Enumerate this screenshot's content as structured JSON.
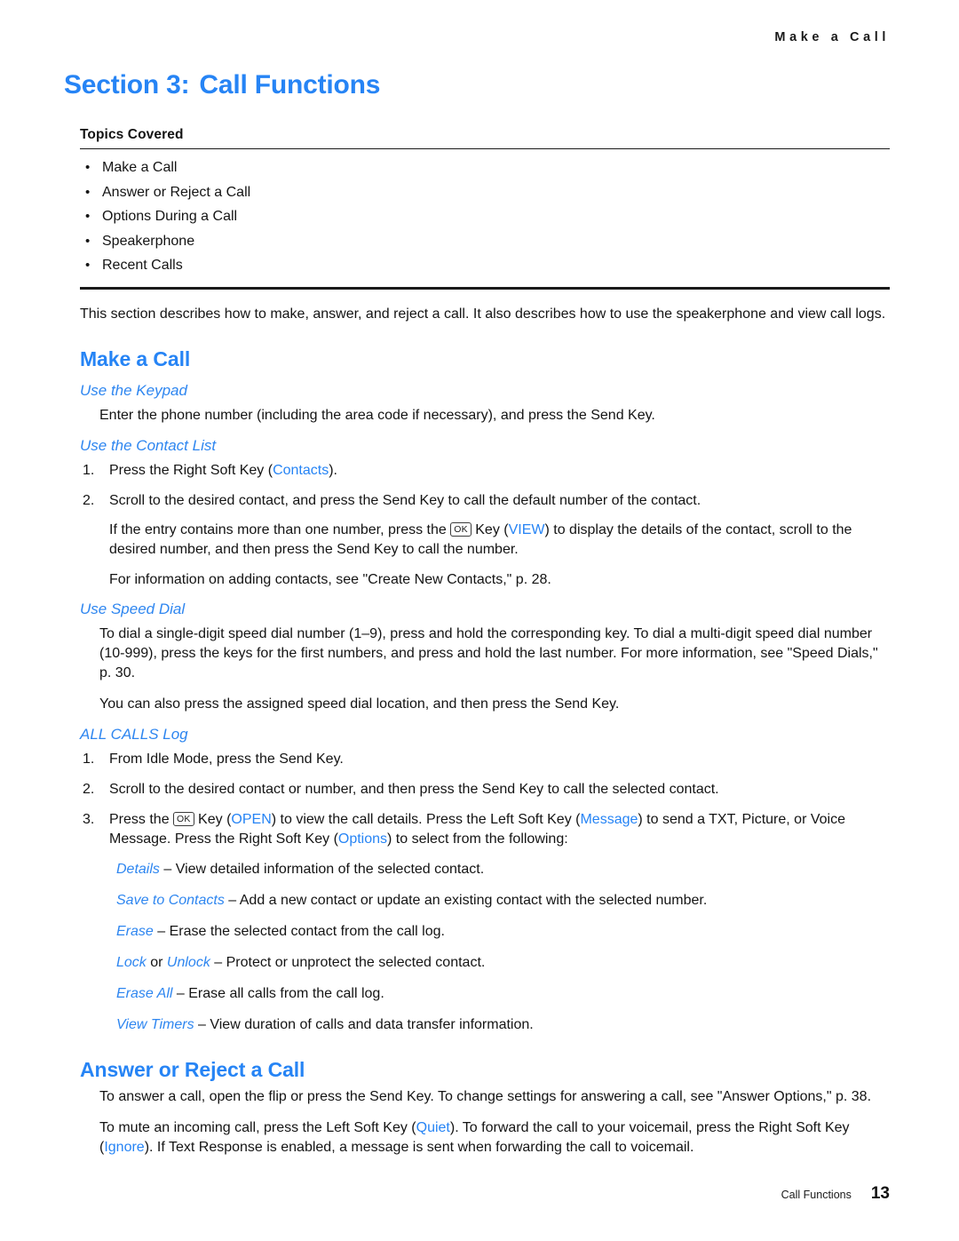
{
  "running_header": "Make a Call",
  "section": {
    "label": "Section 3:",
    "title": "Call Functions"
  },
  "topics": {
    "label": "Topics Covered",
    "bullet_glyph": "•",
    "items": [
      "Make a Call",
      "Answer or Reject a Call",
      "Options During a Call",
      "Speakerphone",
      "Recent Calls"
    ]
  },
  "intro": "This section describes how to make, answer, and reject a call. It also describes how to use the speakerphone and view call logs.",
  "make_a_call": {
    "heading": "Make a Call",
    "keypad": {
      "heading": "Use the Keypad",
      "text": "Enter the phone number (including the area code if necessary), and press the Send Key."
    },
    "contact_list": {
      "heading": "Use the Contact List",
      "step1": {
        "num": "1.",
        "pre": "Press the Right Soft Key (",
        "link": "Contacts",
        "post": ")."
      },
      "step2": {
        "num": "2.",
        "text": "Scroll to the desired contact, and press the Send Key to call the default number of the contact.",
        "note_pre": "If the entry contains more than one number, press the ",
        "okkey": "OK",
        "note_mid": " Key (",
        "note_link": "VIEW",
        "note_post": ") to display the details of the contact, scroll to the desired number, and then press the Send Key to call the number."
      },
      "footnote": "For information on adding contacts, see \"Create New Contacts,\" p. 28."
    },
    "speed_dial": {
      "heading": "Use Speed Dial",
      "para1": "To dial a single-digit speed dial number (1–9), press and hold the corresponding key. To dial a multi-digit speed dial number (10-999), press the keys for the first numbers, and press and hold the last number. For more information, see \"Speed Dials,\" p. 30.",
      "para2": "You can also press the assigned speed dial location, and then press the Send Key."
    },
    "all_calls": {
      "heading": "ALL CALLS Log",
      "step1": {
        "num": "1.",
        "text": "From Idle Mode, press the Send Key."
      },
      "step2": {
        "num": "2.",
        "text": "Scroll to the desired contact or number, and then press the Send Key to call the selected contact."
      },
      "step3": {
        "num": "3.",
        "p1": "Press the ",
        "okkey": "OK",
        "p2": " Key (",
        "link_open": "OPEN",
        "p3": ") to view the call details. Press the Left Soft Key (",
        "link_message": "Message",
        "p4": ") to send a TXT, Picture, or Voice Message. Press the Right Soft Key (",
        "link_options": "Options",
        "p5": ") to select from the following:"
      },
      "options": [
        {
          "term": "Details",
          "desc": " – View detailed information of the selected contact."
        },
        {
          "term": "Save to Contacts",
          "desc": " – Add a new contact or update an existing contact with the selected number."
        },
        {
          "term": "Erase",
          "desc": " – Erase the selected contact from the call log."
        },
        {
          "term": "Lock",
          "conj": " or ",
          "term2": "Unlock",
          "desc": " – Protect or unprotect the selected contact."
        },
        {
          "term": "Erase All",
          "desc": " – Erase all calls from the call log."
        },
        {
          "term": "View Timers",
          "desc": " – View duration of calls and data transfer information."
        }
      ]
    }
  },
  "answer_reject": {
    "heading": "Answer or Reject a Call",
    "para1": "To answer a call, open the flip or press the Send Key. To change settings for answering a call, see \"Answer Options,\" p. 38.",
    "para2_pre": "To mute an incoming call, press the Left Soft Key (",
    "para2_link1": "Quiet",
    "para2_mid": "). To forward the call to your voicemail, press the Right Soft Key (",
    "para2_link2": "Ignore",
    "para2_post": "). If Text Response is enabled, a message is sent when forwarding the call to voicemail."
  },
  "footer": {
    "label": "Call Functions",
    "page": "13"
  },
  "colors": {
    "accent_blue": "#2684f5",
    "subhead_blue": "#2e86f0",
    "body_text": "#141414"
  }
}
